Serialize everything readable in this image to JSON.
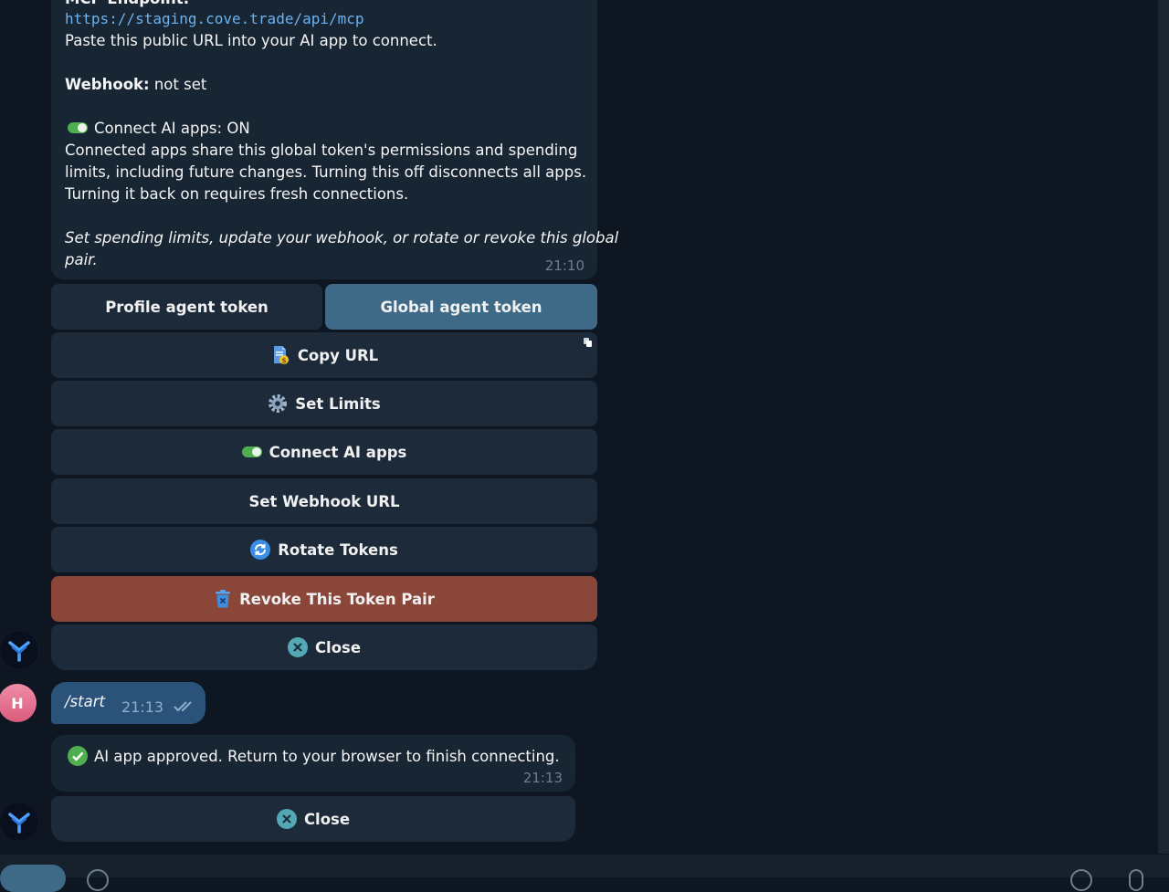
{
  "message": {
    "endpoint_heading": "MCP Endpoint:",
    "endpoint_url": "https://staging.cove.trade/api/mcp",
    "endpoint_hint": "Paste this public URL into your AI app to connect.",
    "webhook_label": "Webhook:",
    "webhook_value": " not set",
    "connect_status": "Connect AI apps: ON",
    "connect_desc_1": "Connected apps share this global token's permissions and spending",
    "connect_desc_2": "limits, including future changes. Turning this off disconnects all apps.",
    "connect_desc_3": "Turning it back on requires fresh connections.",
    "footer_1": "Set spending limits, update your webhook, or rotate or revoke this global",
    "footer_2": "pair.",
    "time": "21:10"
  },
  "keyboard": {
    "profile_token": "Profile agent token",
    "global_token": "Global agent token",
    "copy_url": "Copy URL",
    "set_limits": "Set Limits",
    "connect_ai_apps": "Connect AI apps",
    "set_webhook": "Set Webhook URL",
    "rotate_tokens": "Rotate Tokens",
    "revoke": "Revoke This Token Pair",
    "close": "Close"
  },
  "outgoing": {
    "text": "/start",
    "time": "21:13"
  },
  "user_avatar": {
    "initial": "H"
  },
  "approved": {
    "text": "AI app approved. Return to your browser to finish connecting.",
    "time": "21:13",
    "close": "Close"
  },
  "colors": {
    "background": "#0e1621",
    "bubble": "#182533",
    "button": "#1c2a3a",
    "active_button": "#3e6a87",
    "danger_button": "#8a4638",
    "link": "#6ab3f3",
    "outgoing_bubble": "#2b5278"
  }
}
